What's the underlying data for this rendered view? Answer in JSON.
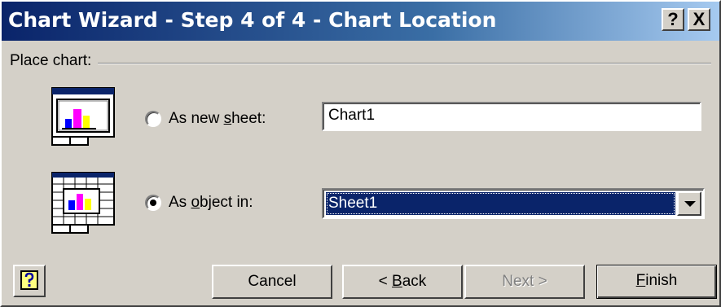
{
  "window": {
    "title": "Chart Wizard - Step 4 of 4 - Chart Location",
    "help_button": "?",
    "close_button": "X"
  },
  "place_chart": {
    "group_label": "Place chart:",
    "options": [
      {
        "label_pre": "As new ",
        "label_accel": "s",
        "label_post": "heet:",
        "selected": false,
        "value": "Chart1",
        "icon": "chart-sheet-icon"
      },
      {
        "label_pre": "As ",
        "label_accel": "o",
        "label_post": "bject in:",
        "selected": true,
        "value": "Sheet1",
        "icon": "embedded-chart-icon"
      }
    ]
  },
  "buttons": {
    "cancel": "Cancel",
    "back_pre": "< ",
    "back_accel": "B",
    "back_post": "ack",
    "next": "Next >",
    "finish_accel": "F",
    "finish_post": "inish"
  },
  "icons": {
    "help": "office-assistant-help-icon"
  },
  "colors": {
    "title_start": "#0a246a",
    "title_end": "#a6caf0",
    "selection": "#0a246a",
    "face": "#d4d0c8"
  }
}
